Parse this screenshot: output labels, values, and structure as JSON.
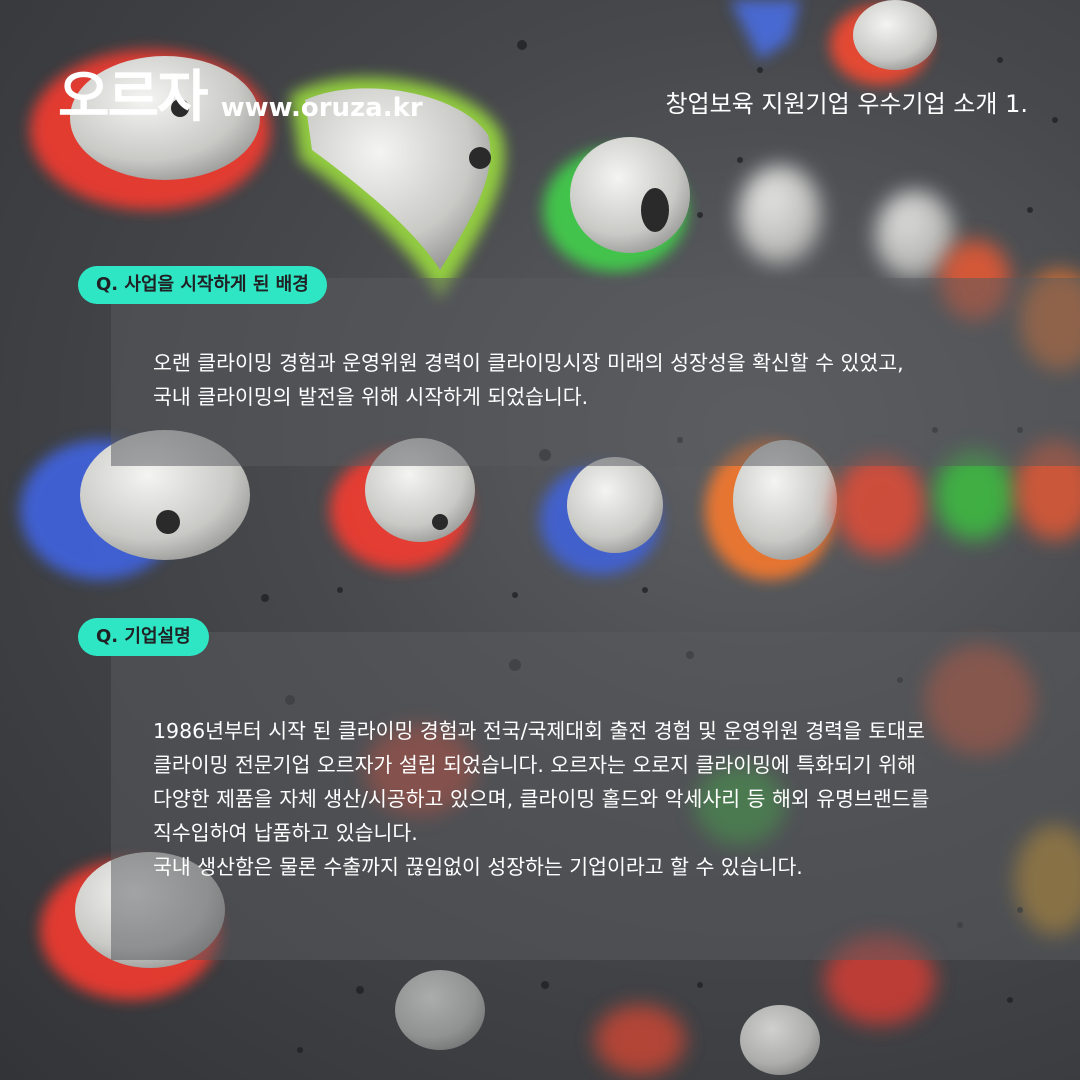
{
  "header": {
    "brand_name": "오르자",
    "brand_url": "www.oruza.kr",
    "series_title": "창업보육 지원기업 우수기업 소개 1."
  },
  "sections": [
    {
      "question": "Q. 사업을 시작하게 된 배경",
      "lines": [
        "오랜 클라이밍 경험과 운영위원 경력이 클라이밍시장 미래의 성장성을 확신할 수 있었고,",
        "국내 클라이밍의 발전을 위해 시작하게 되었습니다."
      ]
    },
    {
      "question": "Q. 기업설명",
      "lines": [
        "1986년부터 시작 된 클라이밍 경험과 전국/국제대회 출전 경험 및 운영위원 경력을 토대로",
        "클라이밍 전문기업 오르자가 설립 되었습니다. 오르자는 오로지 클라이밍에 특화되기 위해",
        "다양한 제품을 자체 생산/시공하고 있으며, 클라이밍 홀드와 악세사리 등 해외 유명브랜드를",
        "직수입하여 납품하고 있습니다.",
        "국내 생산함은 물론 수출까지 끊임없이 성장하는 기업이라고 할 수 있습니다."
      ]
    }
  ],
  "colors": {
    "pill_background": "#2fe6c4",
    "hold_accents": [
      "#ff3b2f",
      "#9be63a",
      "#3f6ee0",
      "#ff7a2a",
      "#39d43b"
    ]
  }
}
